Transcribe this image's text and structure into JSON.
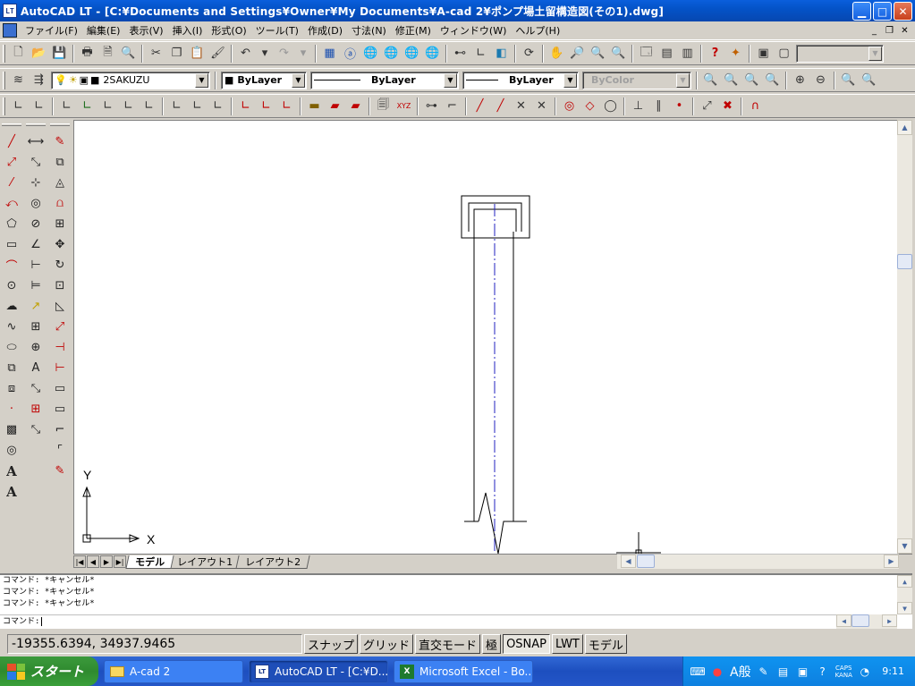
{
  "window": {
    "app_icon": "LT",
    "title": "AutoCAD LT - [C:¥Documents and Settings¥Owner¥My Documents¥A-cad 2¥ポンプ場土留構造図(その1).dwg]",
    "minimize": "▁",
    "maximize": "□",
    "close": "✕"
  },
  "menu": {
    "items": [
      "ファイル(F)",
      "編集(E)",
      "表示(V)",
      "挿入(I)",
      "形式(O)",
      "ツール(T)",
      "作成(D)",
      "寸法(N)",
      "修正(M)",
      "ウィンドウ(W)",
      "ヘルプ(H)"
    ],
    "mdi_minimize": "_",
    "mdi_restore": "❐",
    "mdi_close": "✕"
  },
  "layers": {
    "current_layer": "2SAKUZU",
    "color": "ByLayer",
    "linetype": "ByLayer",
    "lineweight": "ByLayer",
    "plotstyle": "ByColor"
  },
  "canvas": {
    "ucs_y": "Y",
    "ucs_x": "X"
  },
  "tabs": [
    "モデル",
    "レイアウト1",
    "レイアウト2"
  ],
  "command": {
    "history": [
      "コマンド: *キャンセル*",
      "コマンド: *キャンセル*",
      "コマンド: *キャンセル*"
    ],
    "prompt": "コマンド:"
  },
  "status": {
    "coords": "-19355.6394, 34937.9465",
    "toggles": [
      {
        "label": "スナップ",
        "on": false
      },
      {
        "label": "グリッド",
        "on": false
      },
      {
        "label": "直交モード",
        "on": false
      },
      {
        "label": "極",
        "on": false
      },
      {
        "label": "OSNAP",
        "on": true
      },
      {
        "label": "LWT",
        "on": false
      },
      {
        "label": "モデル",
        "on": false
      }
    ]
  },
  "taskbar": {
    "start": "スタート",
    "tasks": [
      {
        "label": "A-cad 2",
        "icon": "folder-icon"
      },
      {
        "label": "AutoCAD LT - [C:¥D...",
        "icon": "autocad-icon"
      },
      {
        "label": "Microsoft Excel - Bo...",
        "icon": "excel-icon"
      }
    ],
    "ime": "A般",
    "caps": "CAPS",
    "kana": "KANA",
    "clock": "9:11"
  },
  "colors": {
    "titlebar": "#0453c8",
    "taskbar": "#245edc",
    "start": "#3a9a3a",
    "canvas": "#ffffff",
    "centerline": "#2020c0"
  }
}
